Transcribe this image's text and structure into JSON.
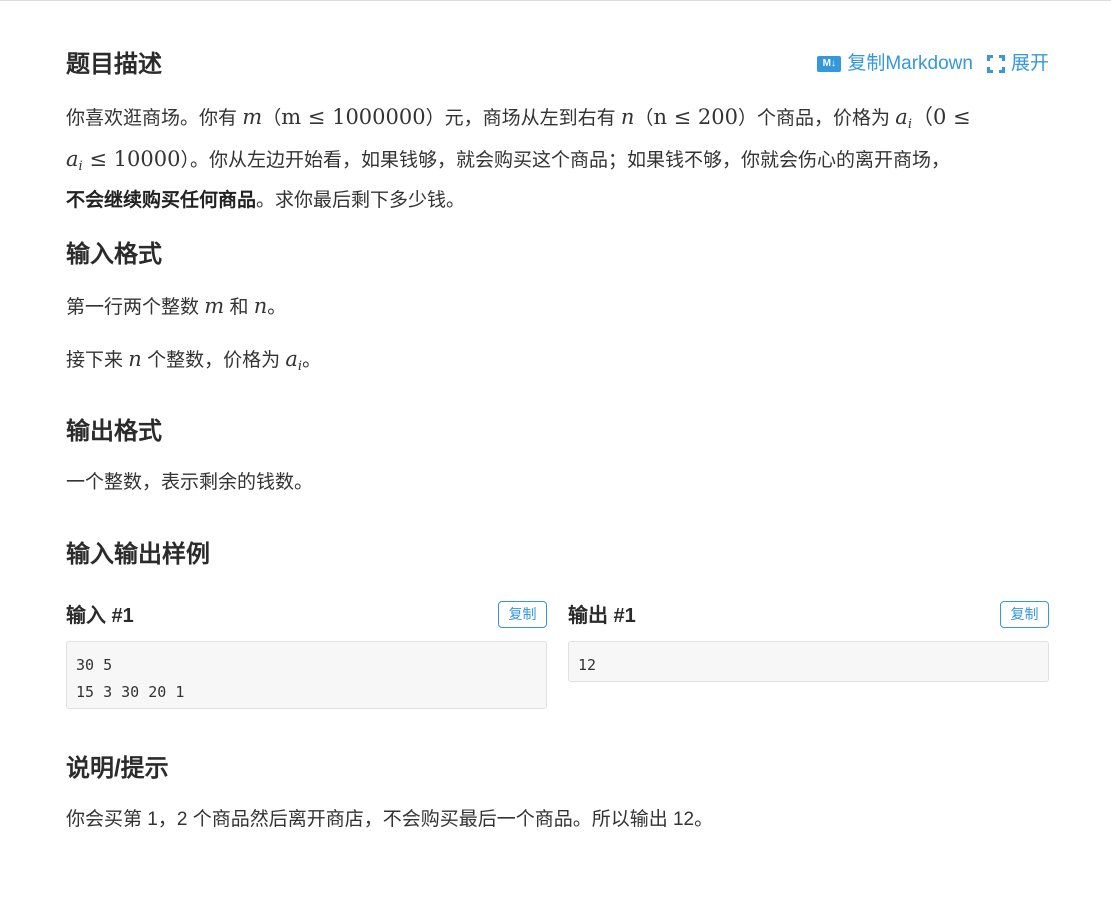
{
  "sections": {
    "description": {
      "title": "题目描述",
      "actions": {
        "md_icon": "M↓",
        "copy_markdown_label": "复制Markdown",
        "expand_label": "展开"
      },
      "line1_a": "你喜欢逛商场。你有 ",
      "line1_m": "m",
      "line1_paren1": "（",
      "line1_cond1": "m ≤ 1000000",
      "line1_b": "）元，商场从左到右有 ",
      "line1_n": "n",
      "line1_paren2": "（",
      "line1_cond2": "n ≤ 200",
      "line1_c": "）个商品，价格为 ",
      "line1_a_var": "a",
      "line1_a_sub": "i",
      "line1_paren3": "（0 ≤",
      "line2_a_var": "a",
      "line2_a_sub": "i",
      "line2_cond": " ≤ 10000",
      "line2_text": "）。你从左边开始看，如果钱够，就会购买这个商品；如果钱不够，你就会伤心的离开商场，",
      "line3_bold": "不会继续购买任何商品",
      "line3_text": "。求你最后剩下多少钱。"
    },
    "input_format": {
      "title": "输入格式",
      "p1_a": "第一行两个整数 ",
      "p1_m": "m",
      "p1_b": " 和 ",
      "p1_n": "n",
      "p1_c": "。",
      "p2_a": "接下来 ",
      "p2_n": "n",
      "p2_b": " 个整数，价格为 ",
      "p2_var": "a",
      "p2_sub": "i",
      "p2_c": "。"
    },
    "output_format": {
      "title": "输出格式",
      "text": "一个整数，表示剩余的钱数。"
    },
    "samples": {
      "title": "输入输出样例",
      "input_label": "输入 #1",
      "output_label": "输出 #1",
      "copy_label": "复制",
      "input_text": "30 5\n15 3 30 20 1",
      "output_text": "12"
    },
    "hint": {
      "title": "说明/提示",
      "text": "你会买第 1，2 个商品然后离开商店，不会购买最后一个商品。所以输出 12。"
    }
  },
  "colors": {
    "accent": "#3498db",
    "text": "#333333",
    "code_bg": "#f7f7f7"
  }
}
